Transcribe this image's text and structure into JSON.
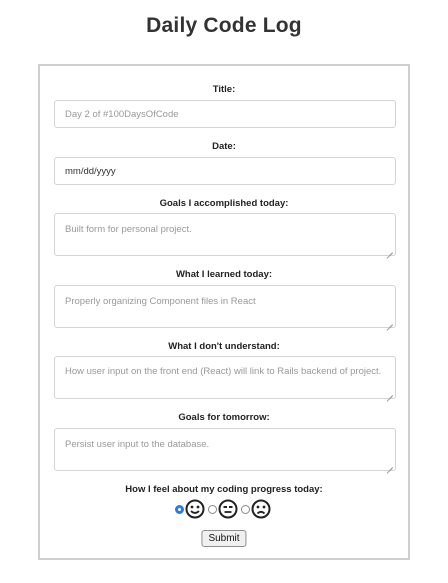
{
  "page_title": "Daily Code Log",
  "form": {
    "title_label": "Title:",
    "title_placeholder": "Day 2 of #100DaysOfCode",
    "date_label": "Date:",
    "date_value": "mm/dd/yyyy",
    "goals_label": "Goals I accomplished today:",
    "goals_placeholder": "Built form for personal project.",
    "learned_label": "What I learned today:",
    "learned_placeholder": "Properly organizing Component files in React",
    "dont_understand_label": "What I don't understand:",
    "dont_understand_placeholder": "How user input on the front end (React) will link to Rails backend of project.",
    "tomorrow_label": "Goals for tomorrow:",
    "tomorrow_placeholder": "Persist user input to the database.",
    "mood_label": "How I feel about my coding progress today:",
    "mood_options": [
      "happy-face",
      "neutral-face",
      "sad-face"
    ],
    "mood_selected": "happy-face",
    "submit_label": "Submit"
  },
  "colors": {
    "radio_checked": "#2f7bd8",
    "border": "#cfcfcf"
  }
}
